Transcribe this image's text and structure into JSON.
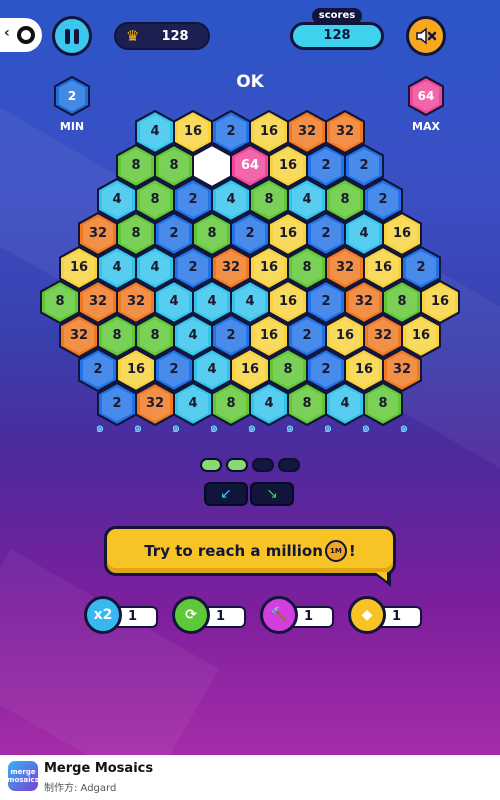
{
  "topbar": {
    "best_score": "128",
    "scores_label": "scores",
    "score": "128"
  },
  "status_text": "OK",
  "min_tile": {
    "value": "2",
    "label": "MIN",
    "color": "#1e6fe0"
  },
  "max_tile": {
    "value": "64",
    "label": "MAX",
    "color": "#f0459a"
  },
  "tile_colors": {
    "2": "#2172e6",
    "4": "#33c4ec",
    "8": "#5ec732",
    "16": "#f7d23a",
    "32": "#f0781f",
    "64": "#f0459a",
    "empty": "#ffffff"
  },
  "board_rows": [
    [
      "4",
      "16",
      "2",
      "16",
      "32",
      "32"
    ],
    [
      "8",
      "8",
      "",
      "64",
      "16",
      "2",
      "2"
    ],
    [
      "4",
      "8",
      "2",
      "4",
      "8",
      "4",
      "8",
      "2"
    ],
    [
      "32",
      "8",
      "2",
      "8",
      "2",
      "16",
      "2",
      "4",
      "16"
    ],
    [
      "16",
      "4",
      "4",
      "2",
      "32",
      "16",
      "8",
      "32",
      "16",
      "2"
    ],
    [
      "8",
      "32",
      "32",
      "4",
      "4",
      "4",
      "16",
      "2",
      "32",
      "8",
      "16"
    ],
    [
      "32",
      "8",
      "8",
      "4",
      "2",
      "16",
      "2",
      "16",
      "32",
      "16"
    ],
    [
      "2",
      "16",
      "2",
      "4",
      "16",
      "8",
      "2",
      "16",
      "32"
    ],
    [
      "2",
      "32",
      "4",
      "8",
      "4",
      "8",
      "4",
      "8"
    ]
  ],
  "progress_dots": {
    "filled": 2,
    "total": 4
  },
  "undo_arrows": [
    "↙",
    "↘"
  ],
  "goal": {
    "text_before": "Try to reach a million",
    "badge": "1M",
    "text_after": "!"
  },
  "powerups": [
    {
      "name": "double",
      "icon_text": "x2",
      "count": "1",
      "color": "#37b8f0"
    },
    {
      "name": "refresh",
      "icon_text": "⟳",
      "count": "1",
      "color": "#5cc83a"
    },
    {
      "name": "hammer",
      "icon_text": "🔨",
      "count": "1",
      "color": "#d43ee0"
    },
    {
      "name": "bomb",
      "icon_text": "◆",
      "count": "1",
      "color": "#f7c325"
    }
  ],
  "footer": {
    "app_name": "Merge Mosaics",
    "developer": "制作方: Adgard",
    "icon_text": "merge mosaics"
  }
}
